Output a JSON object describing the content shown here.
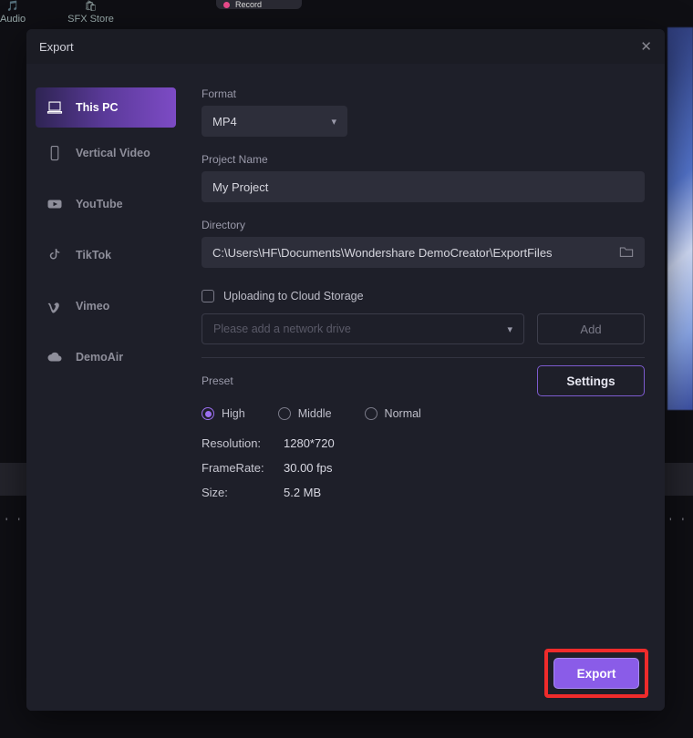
{
  "topbar": {
    "audio": "Audio",
    "sfx": "SFX Store",
    "record": "Record"
  },
  "modal": {
    "title": "Export"
  },
  "sidebar": {
    "items": [
      {
        "key": "this-pc",
        "label": "This PC",
        "active": true
      },
      {
        "key": "vertical-video",
        "label": "Vertical Video",
        "active": false
      },
      {
        "key": "youtube",
        "label": "YouTube",
        "active": false
      },
      {
        "key": "tiktok",
        "label": "TikTok",
        "active": false
      },
      {
        "key": "vimeo",
        "label": "Vimeo",
        "active": false
      },
      {
        "key": "demoair",
        "label": "DemoAir",
        "active": false
      }
    ]
  },
  "form": {
    "format_label": "Format",
    "format_value": "MP4",
    "project_label": "Project Name",
    "project_value": "My Project",
    "directory_label": "Directory",
    "directory_value": "C:\\Users\\HF\\Documents\\Wondershare DemoCreator\\ExportFiles",
    "cloud_label": "Uploading to Cloud Storage",
    "cloud_checked": false,
    "net_placeholder": "Please add a network drive",
    "add_button": "Add"
  },
  "preset": {
    "label": "Preset",
    "settings_button": "Settings",
    "options": [
      {
        "key": "high",
        "label": "High",
        "selected": true
      },
      {
        "key": "middle",
        "label": "Middle",
        "selected": false
      },
      {
        "key": "normal",
        "label": "Normal",
        "selected": false
      }
    ],
    "specs": {
      "resolution_k": "Resolution:",
      "resolution_v": "1280*720",
      "framerate_k": "FrameRate:",
      "framerate_v": "30.00 fps",
      "size_k": "Size:",
      "size_v": "5.2 MB"
    }
  },
  "footer": {
    "export_button": "Export"
  }
}
